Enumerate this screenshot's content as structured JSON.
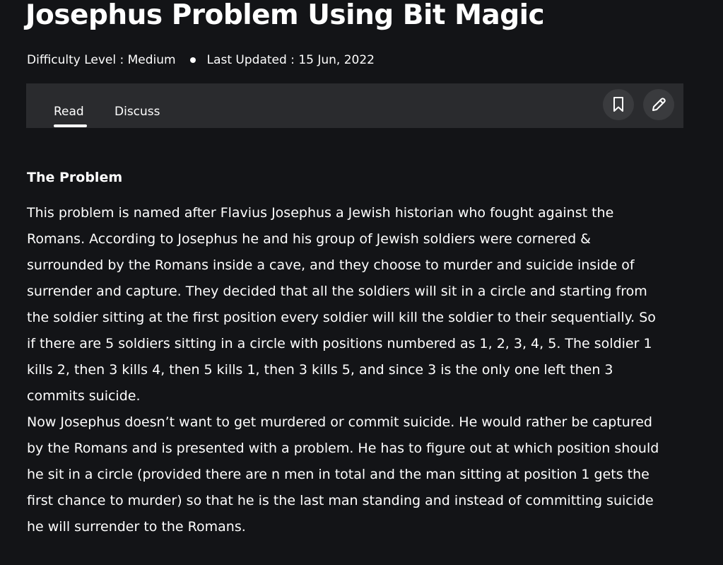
{
  "article": {
    "title": "Josephus Problem Using Bit Magic",
    "difficulty": "Difficulty Level : Medium",
    "last_updated": "Last Updated : 15 Jun, 2022"
  },
  "tabs": {
    "read": "Read",
    "discuss": "Discuss",
    "active": "read"
  },
  "icons": {
    "bookmark": "bookmark-icon",
    "edit": "pencil-icon"
  },
  "content": {
    "heading": "The Problem",
    "lines": [
      "This problem is named after Flavius Josephus a Jewish historian who fought against the",
      "Romans. According to Josephus he and his group of Jewish soldiers were cornered &",
      "surrounded by the Romans inside a cave, and they choose to murder and suicide inside of",
      "surrender and capture. They decided that all the soldiers will sit in a circle and starting from",
      "the soldier sitting at the first position every soldier will kill the soldier to their sequentially. So",
      "if there are 5 soldiers sitting in a circle with positions numbered as 1, 2, 3, 4, 5. The soldier 1",
      "kills 2, then 3 kills 4, then 5 kills 1, then 3 kills 5, and since 3 is the only one left then 3",
      "commits suicide.",
      "Now Josephus doesn’t want to get murdered or commit suicide. He would rather be captured",
      "by the Romans and is presented with a problem. He has to figure out at which position should",
      "he sit in a circle (provided there are n men in total and the man sitting at position 1 gets the",
      "first chance to murder) so that he is the last man standing and instead of committing suicide",
      "he will surrender to the Romans."
    ]
  },
  "colors": {
    "background": "#131417",
    "tab_bar": "#2a2b2e",
    "icon_button": "#3a3b3e",
    "text": "#ffffff"
  }
}
